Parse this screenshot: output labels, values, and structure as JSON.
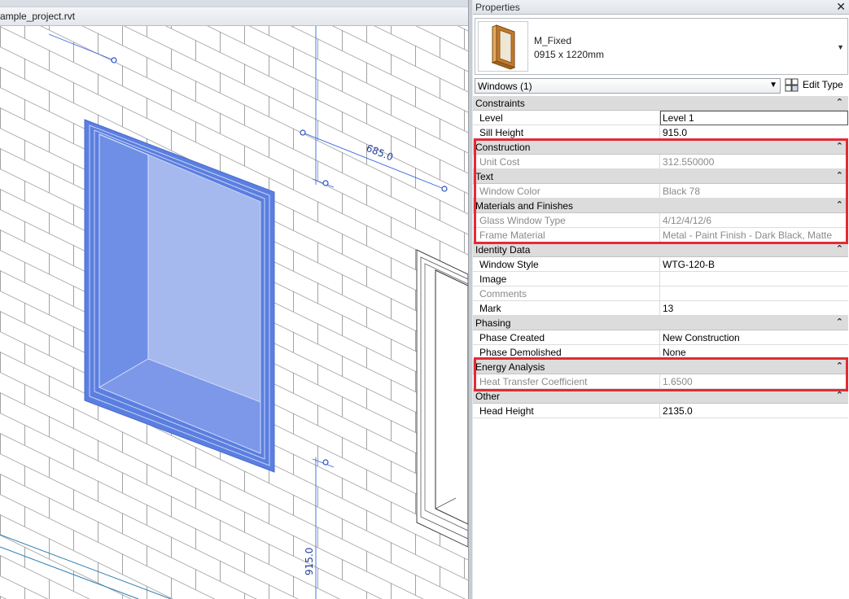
{
  "view": {
    "tab_title": "ample_project.rvt",
    "dimensions": [
      "685.0",
      "915.0"
    ]
  },
  "properties": {
    "title": "Properties",
    "close_glyph": "✕",
    "type": {
      "name": "M_Fixed",
      "size": "0915 x 1220mm",
      "thumbnail_icon": "window-thumbnail-icon"
    },
    "filter": "Windows (1)",
    "edit_type_label": "Edit Type",
    "collapse_glyph": "⌃",
    "groups": [
      {
        "label": "Constraints",
        "rows": [
          {
            "name": "Level",
            "value": "Level 1",
            "readonly": false,
            "editing": true
          },
          {
            "name": "Sill Height",
            "value": "915.0",
            "readonly": false
          }
        ]
      },
      {
        "label": "Construction",
        "rows": [
          {
            "name": "Unit Cost",
            "value": "312.550000",
            "readonly": true
          }
        ]
      },
      {
        "label": "Text",
        "rows": [
          {
            "name": "Window Color",
            "value": "Black 78",
            "readonly": true
          }
        ]
      },
      {
        "label": "Materials and Finishes",
        "rows": [
          {
            "name": "Glass Window Type",
            "value": "4/12/4/12/6",
            "readonly": true
          },
          {
            "name": "Frame Material",
            "value": "Metal - Paint Finish - Dark Black, Matte",
            "readonly": true
          }
        ]
      },
      {
        "label": "Identity Data",
        "rows": [
          {
            "name": "Window Style",
            "value": "WTG-120-B",
            "readonly": false
          },
          {
            "name": "Image",
            "value": "",
            "readonly": false
          },
          {
            "name": "Comments",
            "value": "",
            "readonly": true
          },
          {
            "name": "Mark",
            "value": "13",
            "readonly": false
          }
        ]
      },
      {
        "label": "Phasing",
        "rows": [
          {
            "name": "Phase Created",
            "value": "New Construction",
            "readonly": false
          },
          {
            "name": "Phase Demolished",
            "value": "None",
            "readonly": false
          }
        ]
      },
      {
        "label": "Energy Analysis",
        "rows": [
          {
            "name": "Heat Transfer Coefficient",
            "value": "1.6500",
            "readonly": true
          }
        ]
      },
      {
        "label": "Other",
        "rows": [
          {
            "name": "Head Height",
            "value": "2135.0",
            "readonly": false
          }
        ]
      }
    ]
  },
  "colors": {
    "highlight": "#e32b35",
    "selection_blue": "#5b7fe0",
    "dimension_blue": "#1e3f9a"
  }
}
